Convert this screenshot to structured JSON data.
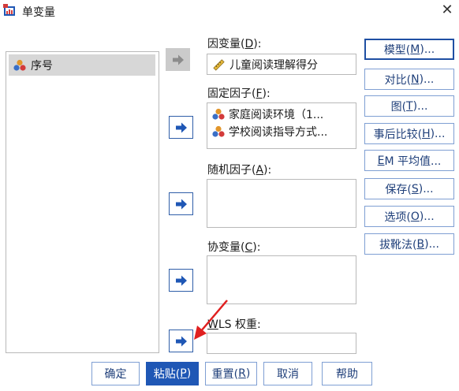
{
  "window": {
    "title": "单变量"
  },
  "source_vars": [
    {
      "label": "序号",
      "icon": "nominal-variable-icon"
    }
  ],
  "dependent": {
    "label": "因变量(",
    "key": "D",
    "suffix": "):",
    "value": "儿童阅读理解得分",
    "icon": "ruler-scale-icon"
  },
  "fixed": {
    "label": "固定因子(",
    "key": "F",
    "suffix": "):",
    "items": [
      {
        "text": "家庭阅读环境（1...",
        "icon": "nominal-variable-icon"
      },
      {
        "text": "学校阅读指导方式...",
        "icon": "nominal-variable-icon"
      }
    ]
  },
  "random": {
    "label": "随机因子(",
    "key": "A",
    "suffix": "):"
  },
  "covariate": {
    "label": "协变量(",
    "key": "C",
    "suffix": "):"
  },
  "wls": {
    "key": "W",
    "label": "LS 权重:"
  },
  "side_buttons": [
    {
      "pre": "模型(",
      "key": "M",
      "post": ")..."
    },
    {
      "pre": "对比(",
      "key": "N",
      "post": ")..."
    },
    {
      "pre": "图(",
      "key": "T",
      "post": ")..."
    },
    {
      "pre": "事后比较(",
      "key": "H",
      "post": ")..."
    },
    {
      "pre": "",
      "key": "E",
      "post": "M 平均值..."
    },
    {
      "pre": "保存(",
      "key": "S",
      "post": ")..."
    },
    {
      "pre": "选项(",
      "key": "O",
      "post": ")..."
    },
    {
      "pre": "拔靴法(",
      "key": "B",
      "post": ")..."
    }
  ],
  "bottom_buttons": [
    {
      "text": "确定"
    },
    {
      "pre": "粘贴(",
      "key": "P",
      "post": ")"
    },
    {
      "pre": "重置(",
      "key": "R",
      "post": ")"
    },
    {
      "text": "取消"
    },
    {
      "text": "帮助"
    }
  ],
  "colors": {
    "accent": "#1f57b5",
    "annotation": "#e02020"
  }
}
